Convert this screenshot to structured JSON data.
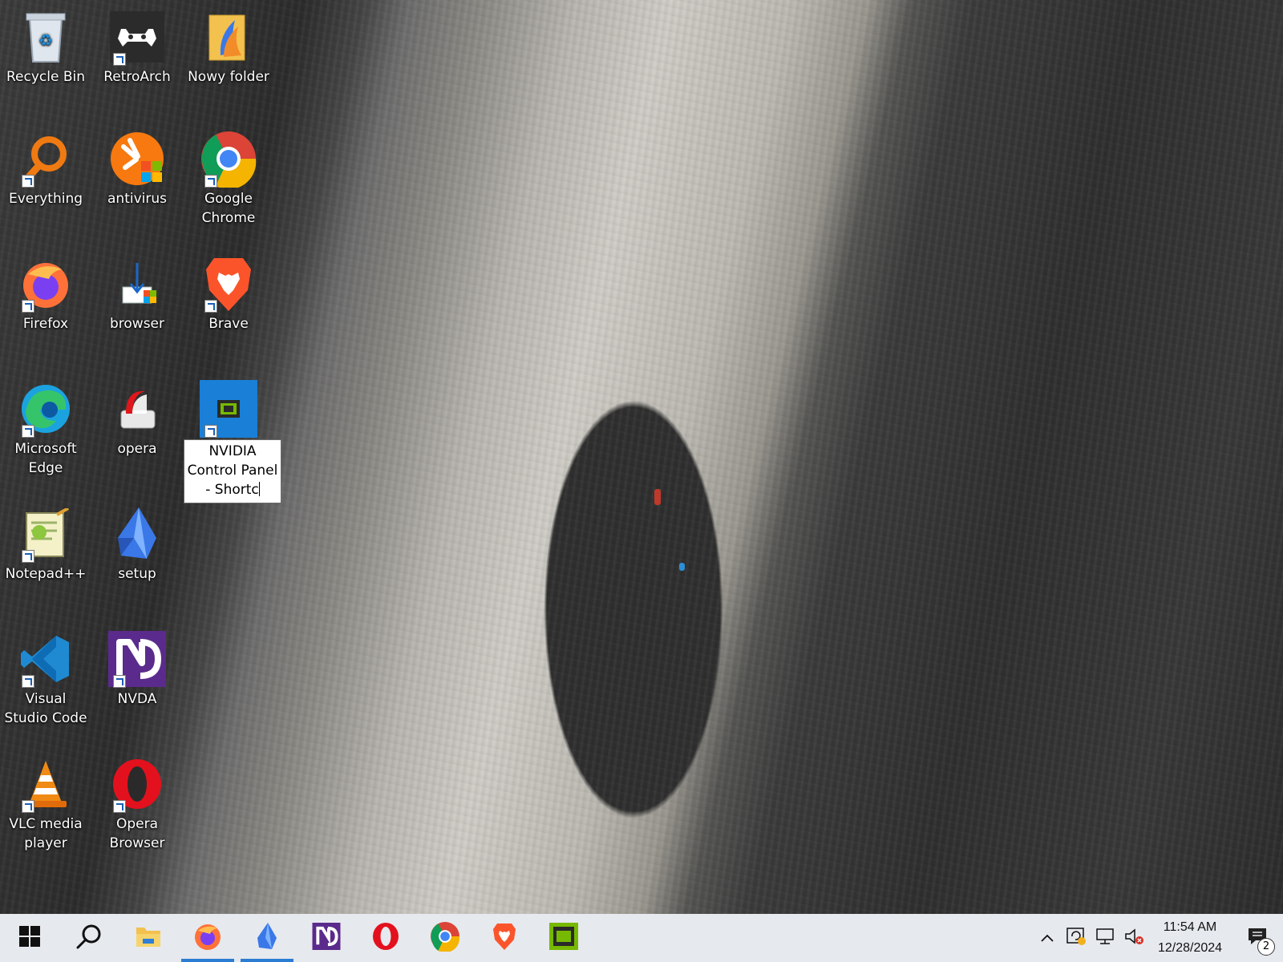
{
  "desktop": {
    "icons": [
      {
        "label": "Recycle Bin",
        "icon": "recycle-bin-icon"
      },
      {
        "label": "RetroArch",
        "icon": "retroarch-icon"
      },
      {
        "label": "Nowy folder",
        "icon": "folder-icon"
      },
      {
        "label": "Everything",
        "icon": "everything-search-icon"
      },
      {
        "label": "antivirus",
        "icon": "antivirus-icon"
      },
      {
        "label": "Google Chrome",
        "icon": "chrome-icon"
      },
      {
        "label": "Firefox",
        "icon": "firefox-icon"
      },
      {
        "label": "browser",
        "icon": "browser-installer-icon"
      },
      {
        "label": "Brave",
        "icon": "brave-icon"
      },
      {
        "label": "Microsoft Edge",
        "icon": "edge-icon"
      },
      {
        "label": "opera",
        "icon": "opera-installer-icon"
      },
      {
        "label": "NVIDIA Control Panel - Shortc",
        "icon": "nvidia-icon",
        "renaming": true
      },
      {
        "label": "Notepad++",
        "icon": "notepad-plus-plus-icon"
      },
      {
        "label": "setup",
        "icon": "setup-icon"
      },
      {
        "label": "Visual Studio Code",
        "icon": "vscode-icon"
      },
      {
        "label": "NVDA",
        "icon": "nvda-icon"
      },
      {
        "label": "VLC media player",
        "icon": "vlc-icon"
      },
      {
        "label": "Opera Browser",
        "icon": "opera-icon"
      }
    ]
  },
  "taskbar": {
    "pinned": [
      {
        "name": "start",
        "icon": "windows-start-icon"
      },
      {
        "name": "search",
        "icon": "search-icon"
      },
      {
        "name": "file-explorer",
        "icon": "file-explorer-icon"
      },
      {
        "name": "firefox",
        "icon": "firefox-icon",
        "active": true
      },
      {
        "name": "setup",
        "icon": "setup-icon",
        "active": true
      },
      {
        "name": "nvda",
        "icon": "nvda-icon"
      },
      {
        "name": "opera",
        "icon": "opera-icon"
      },
      {
        "name": "chrome",
        "icon": "chrome-icon"
      },
      {
        "name": "brave",
        "icon": "brave-icon"
      },
      {
        "name": "nvidia",
        "icon": "nvidia-icon"
      }
    ],
    "tray": {
      "time": "11:54 AM",
      "date": "12/28/2024",
      "notification_count": "2"
    }
  },
  "colors": {
    "taskbar_bg": "#e6e9ee",
    "active_indicator": "#2b7cd3"
  }
}
